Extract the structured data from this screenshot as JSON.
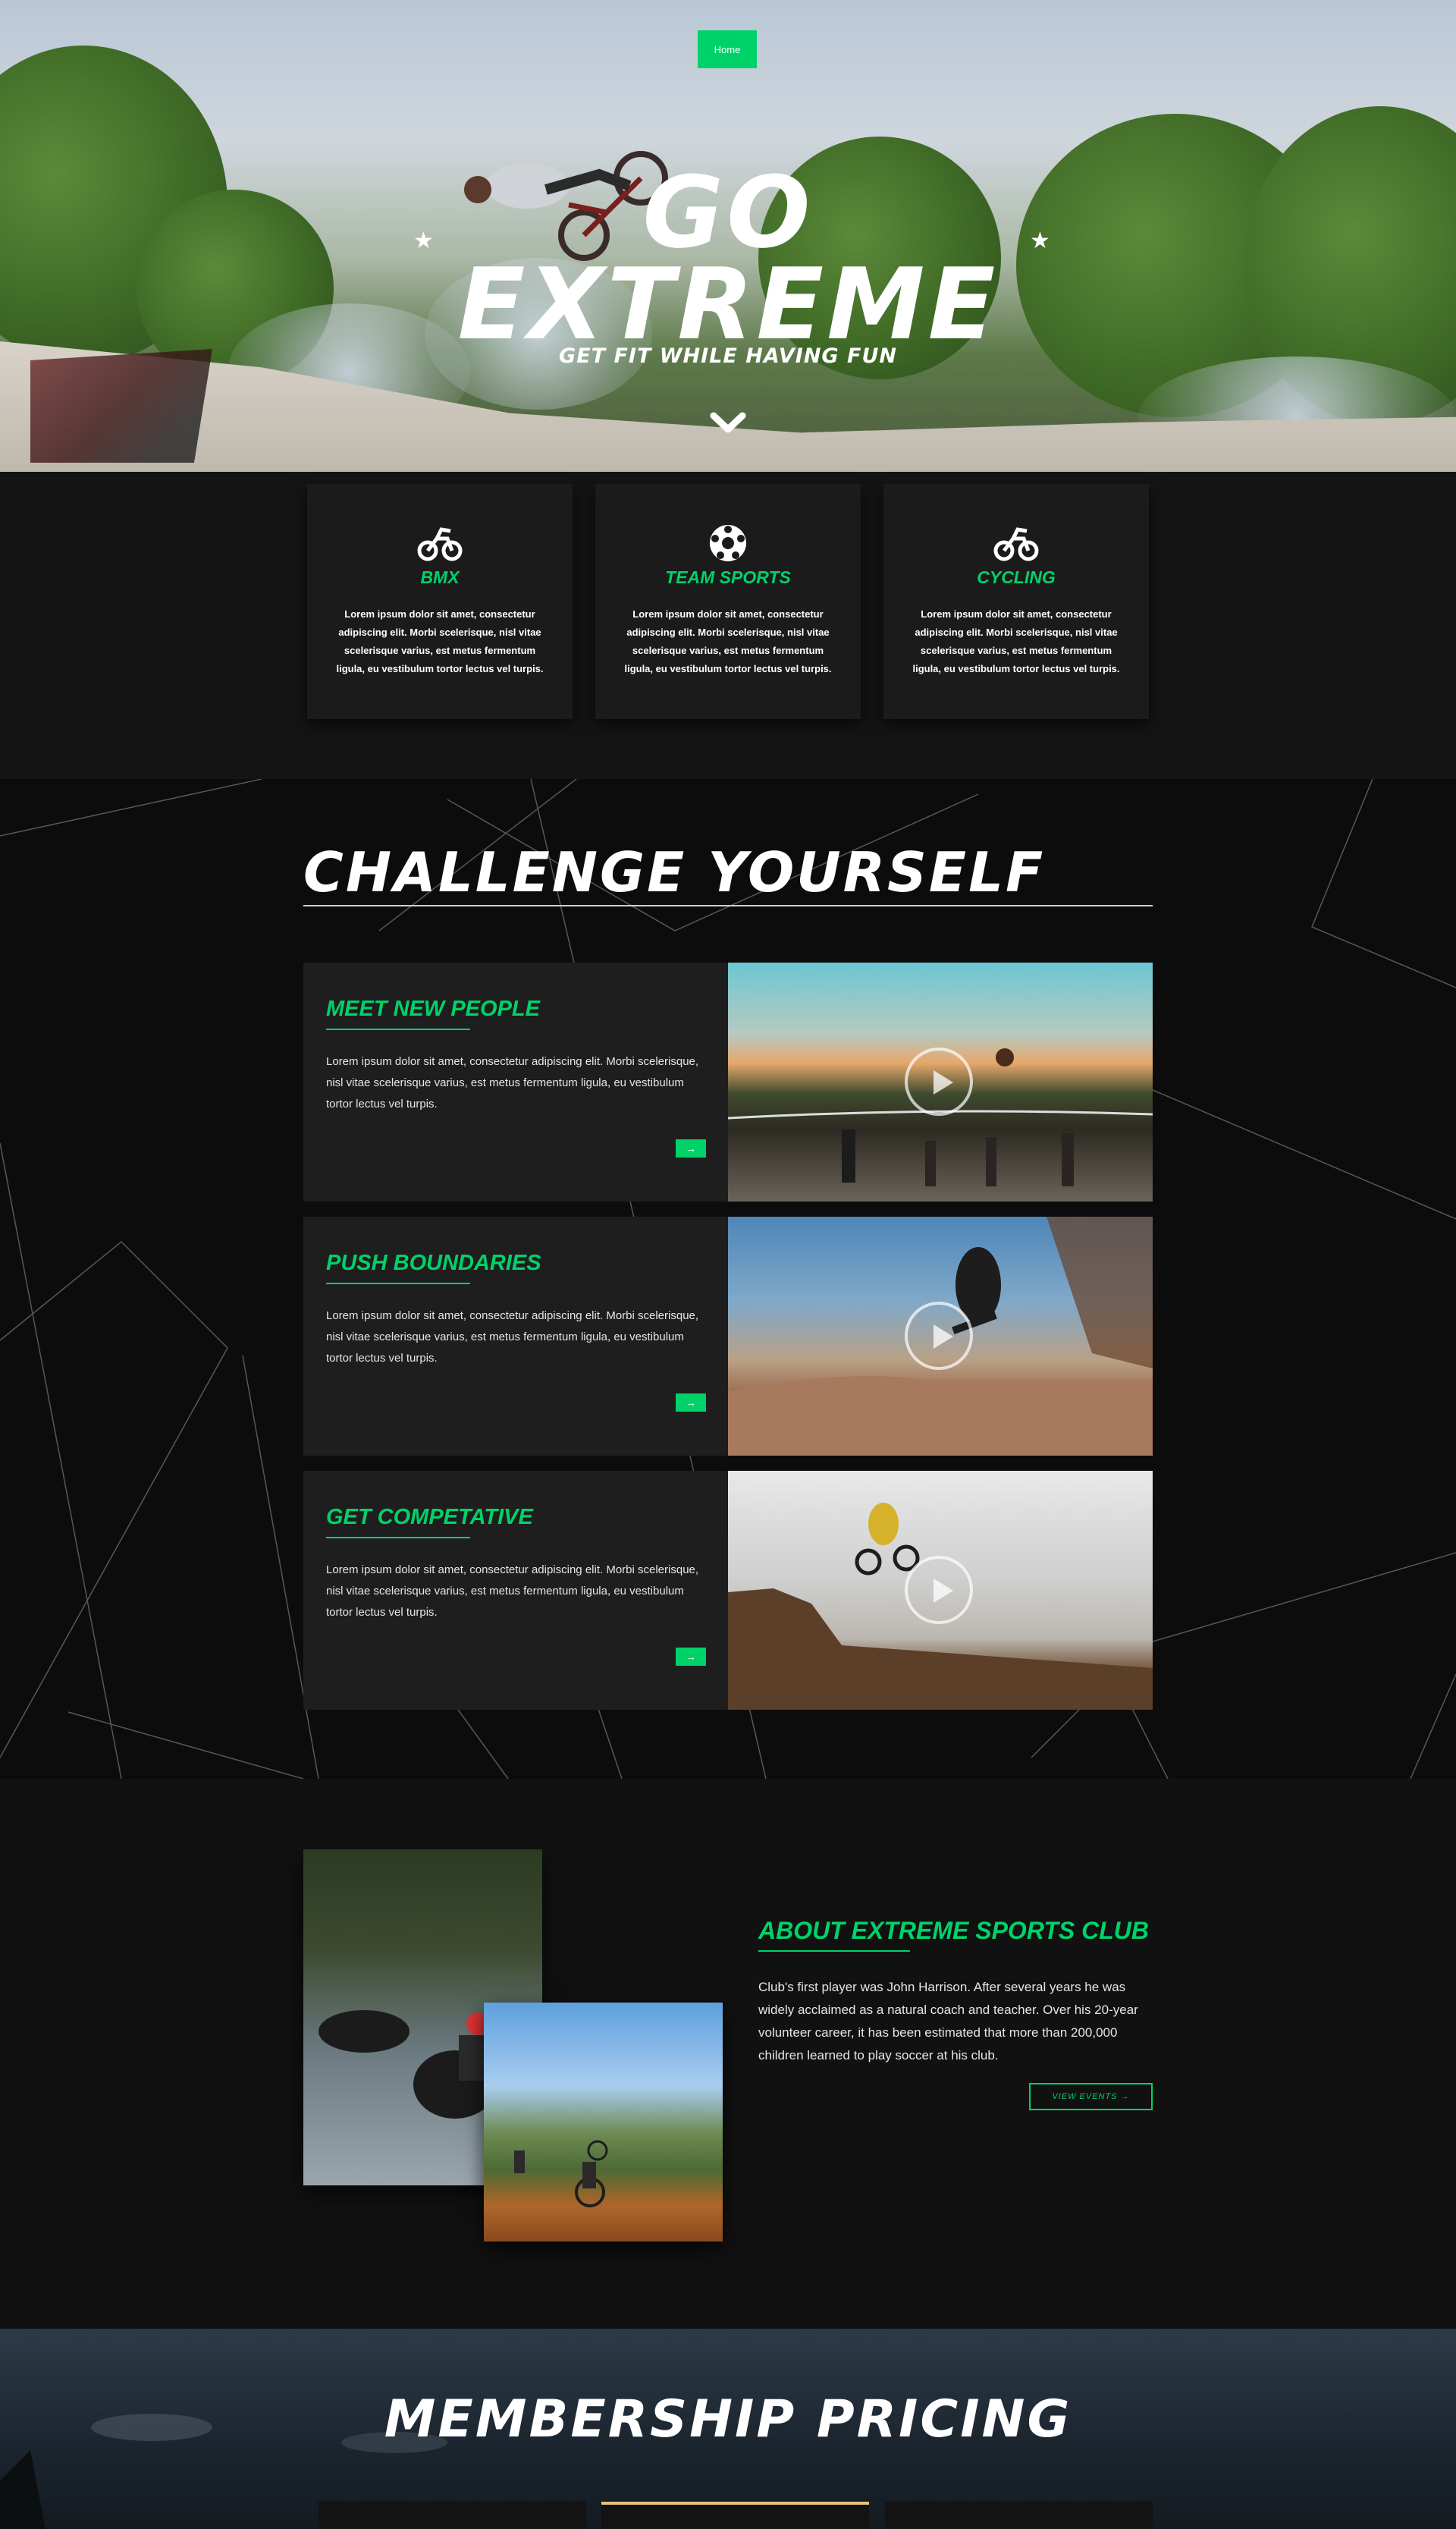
{
  "nav": {
    "home_label": "Home"
  },
  "hero": {
    "title_line1": "GO",
    "title_line2": "EXTREME",
    "subtitle": "GET FIT WHILE HAVING FUN"
  },
  "features": [
    {
      "icon": "motorbike-icon",
      "title": "BMX",
      "text": "Lorem ipsum dolor sit amet, consectetur adipiscing elit. Morbi scelerisque, nisl vitae scelerisque varius, est metus fermentum ligula, eu vestibulum tortor lectus vel turpis."
    },
    {
      "icon": "soccer-ball-icon",
      "title": "TEAM SPORTS",
      "text": "Lorem ipsum dolor sit amet, consectetur adipiscing elit. Morbi scelerisque, nisl vitae scelerisque varius, est metus fermentum ligula, eu vestibulum tortor lectus vel turpis."
    },
    {
      "icon": "motorbike-icon",
      "title": "CYCLING",
      "text": "Lorem ipsum dolor sit amet, consectetur adipiscing elit. Morbi scelerisque, nisl vitae scelerisque varius, est metus fermentum ligula, eu vestibulum tortor lectus vel turpis."
    }
  ],
  "challenge": {
    "title": "CHALLENGE YOURSELF",
    "rows": [
      {
        "title": "MEET NEW PEOPLE",
        "text": "Lorem ipsum dolor sit amet, consectetur adipiscing elit. Morbi scelerisque, nisl vitae scelerisque varius, est metus fermentum ligula, eu vestibulum tortor lectus vel turpis.",
        "arrow": "→"
      },
      {
        "title": "PUSH BOUNDARIES",
        "text": "Lorem ipsum dolor sit amet, consectetur adipiscing elit. Morbi scelerisque, nisl vitae scelerisque varius, est metus fermentum ligula, eu vestibulum tortor lectus vel turpis.",
        "arrow": "→"
      },
      {
        "title": "GET COMPETATIVE",
        "text": "Lorem ipsum dolor sit amet, consectetur adipiscing elit. Morbi scelerisque, nisl vitae scelerisque varius, est metus fermentum ligula, eu vestibulum tortor lectus vel turpis.",
        "arrow": "→"
      }
    ]
  },
  "about": {
    "title": "ABOUT EXTREME SPORTS CLUB",
    "text": "Club's first player was John Harrison. After several years he was widely acclaimed as a natural coach and teacher. Over his 20-year volunteer career, it has been estimated that more than 200,000 children learned to play soccer at his club.",
    "button": "VIEW EVENTS →"
  },
  "pricing": {
    "title": "MEMBERSHIP PRICING"
  },
  "colors": {
    "accent": "#00d26a",
    "gold": "#e8c27a"
  }
}
